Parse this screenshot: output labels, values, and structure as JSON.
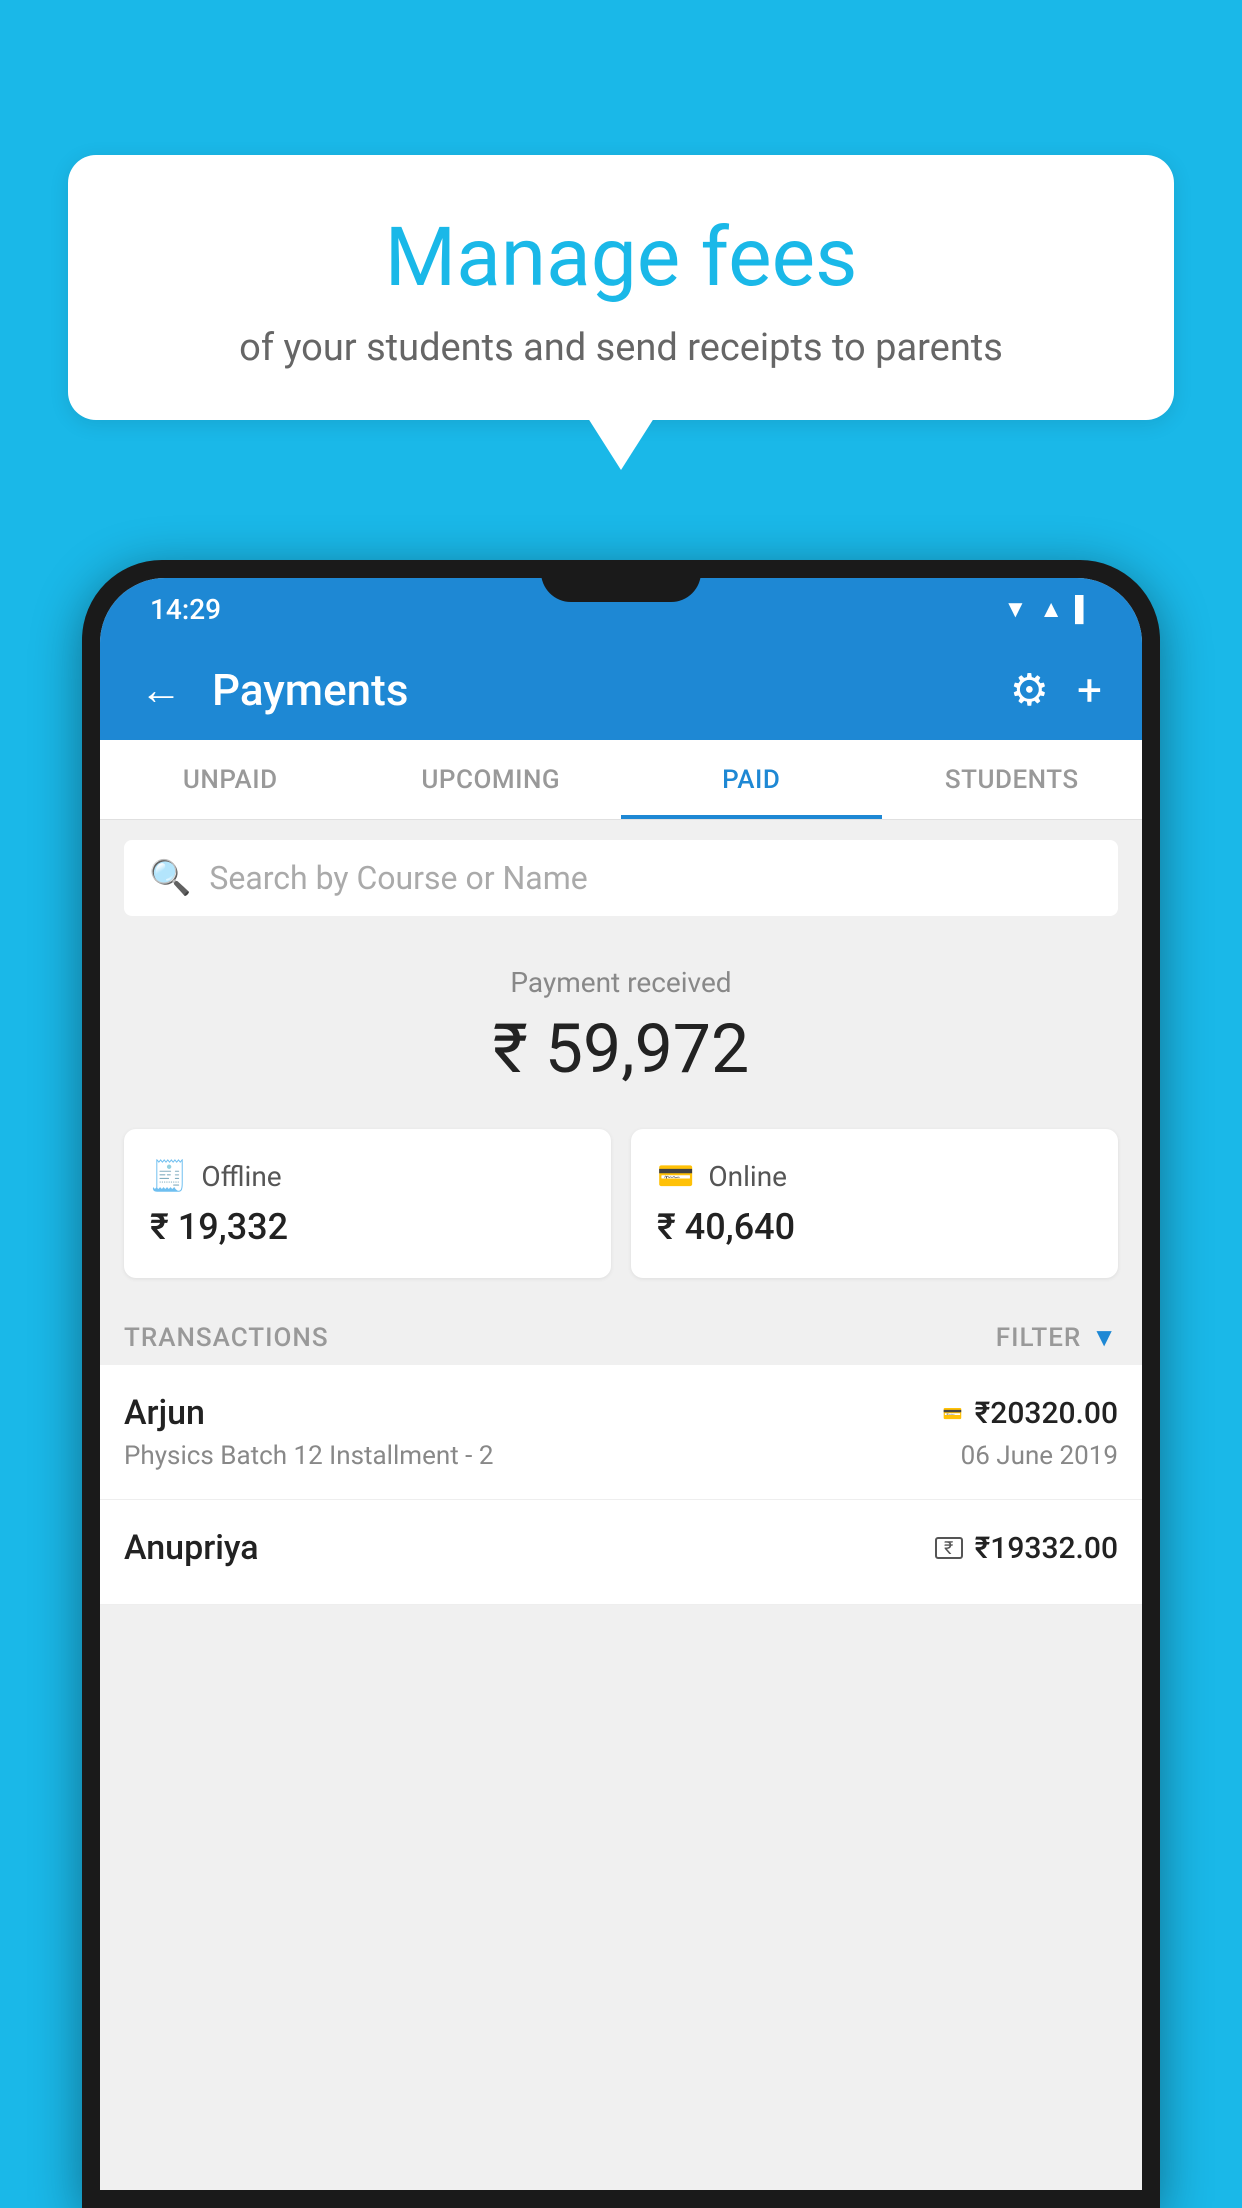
{
  "background_color": "#1ab8e8",
  "speech_bubble": {
    "title": "Manage fees",
    "subtitle": "of your students and send receipts to parents"
  },
  "status_bar": {
    "time": "14:29",
    "icons": [
      "wifi",
      "signal",
      "battery"
    ]
  },
  "app_bar": {
    "title": "Payments",
    "back_label": "←",
    "gear_label": "⚙",
    "plus_label": "+"
  },
  "tabs": [
    {
      "label": "UNPAID",
      "active": false
    },
    {
      "label": "UPCOMING",
      "active": false
    },
    {
      "label": "PAID",
      "active": true
    },
    {
      "label": "STUDENTS",
      "active": false
    }
  ],
  "search": {
    "placeholder": "Search by Course or Name"
  },
  "payment_section": {
    "label": "Payment received",
    "amount": "₹ 59,972"
  },
  "payment_cards": [
    {
      "icon": "offline",
      "label": "Offline",
      "amount": "₹ 19,332"
    },
    {
      "icon": "online",
      "label": "Online",
      "amount": "₹ 40,640"
    }
  ],
  "transactions": {
    "label": "TRANSACTIONS",
    "filter_label": "FILTER",
    "items": [
      {
        "name": "Arjun",
        "amount": "₹20320.00",
        "course": "Physics Batch 12 Installment - 2",
        "date": "06 June 2019",
        "payment_type": "card"
      },
      {
        "name": "Anupriya",
        "amount": "₹19332.00",
        "course": "",
        "date": "",
        "payment_type": "rupee"
      }
    ]
  }
}
